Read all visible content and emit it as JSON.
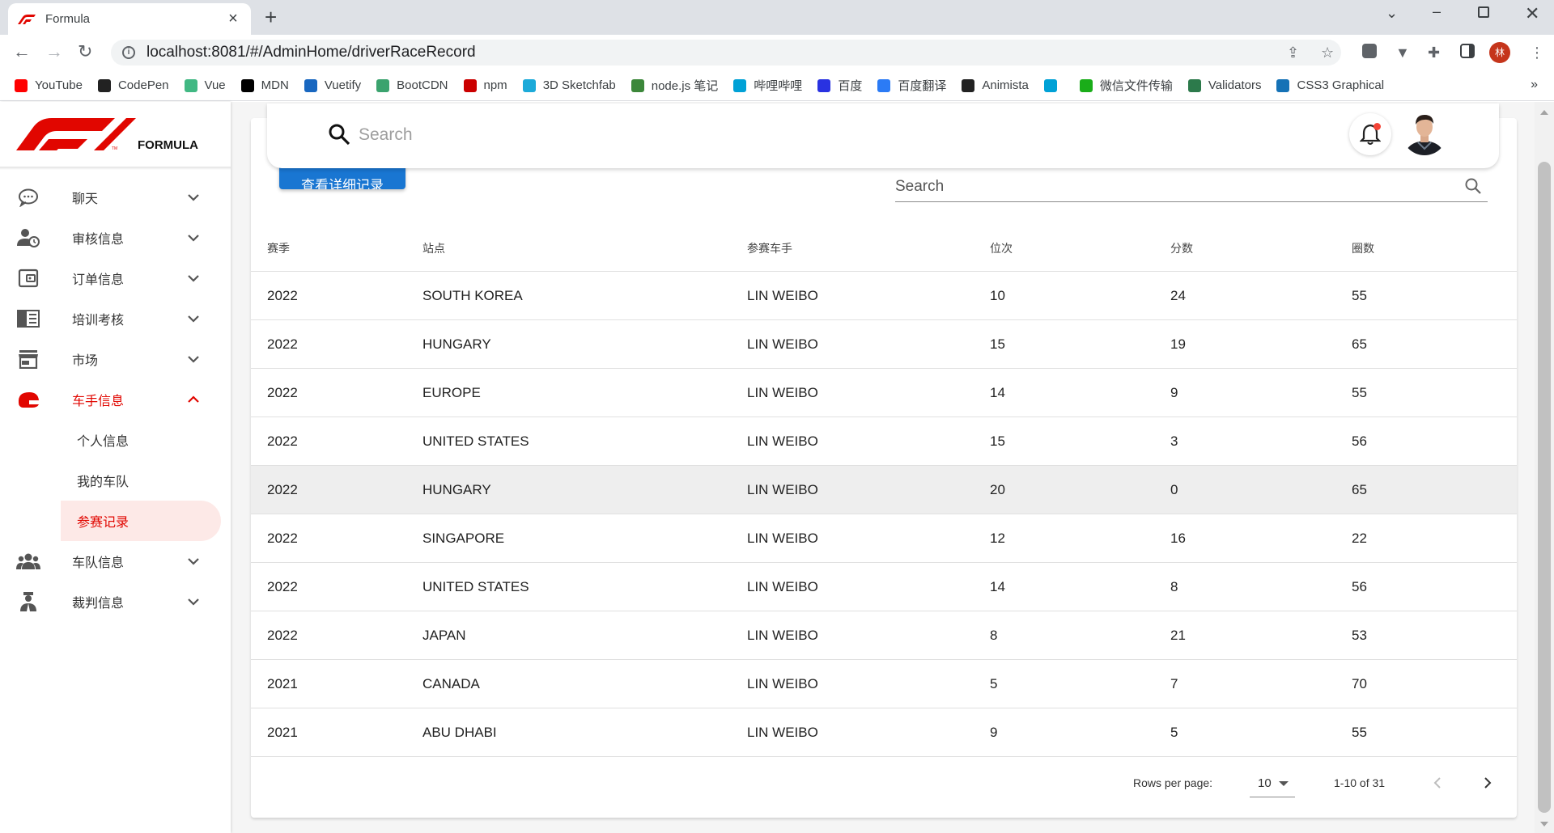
{
  "browser": {
    "tab_title": "Formula",
    "url": "localhost:8081/#/AdminHome/driverRaceRecord",
    "profile_initial": "林",
    "bookmarks": [
      {
        "label": "YouTube",
        "color": "#ff0000"
      },
      {
        "label": "CodePen",
        "color": "#222222"
      },
      {
        "label": "Vue",
        "color": "#41b883"
      },
      {
        "label": "MDN",
        "color": "#000000"
      },
      {
        "label": "Vuetify",
        "color": "#1867c0"
      },
      {
        "label": "BootCDN",
        "color": "#3ba36e"
      },
      {
        "label": "npm",
        "color": "#cb0000"
      },
      {
        "label": "3D Sketchfab",
        "color": "#1caad9"
      },
      {
        "label": "node.js 笔记",
        "color": "#3c873a"
      },
      {
        "label": "哔哩哔哩",
        "color": "#00a1d6"
      },
      {
        "label": "百度",
        "color": "#2932e1"
      },
      {
        "label": "百度翻译",
        "color": "#2b7bf5"
      },
      {
        "label": "Animista",
        "color": "#222222"
      },
      {
        "label": "",
        "color": "#00a1d6"
      },
      {
        "label": "微信文件传输",
        "color": "#1aad19"
      },
      {
        "label": "Validators",
        "color": "#2c7a4b"
      },
      {
        "label": "CSS3 Graphical",
        "color": "#1572b6"
      }
    ],
    "bookmarks_more": "»"
  },
  "brand": {
    "logo_text": "FORMULA",
    "logo_color": "#e10600"
  },
  "sidebar": {
    "items": [
      {
        "label": "聊天",
        "icon": "chat-icon"
      },
      {
        "label": "审核信息",
        "icon": "user-clock-icon"
      },
      {
        "label": "订单信息",
        "icon": "wallet-icon"
      },
      {
        "label": "培训考核",
        "icon": "book-icon"
      },
      {
        "label": "市场",
        "icon": "store-icon"
      },
      {
        "label": "车手信息",
        "icon": "helmet-icon"
      }
    ],
    "sub_items": [
      {
        "label": "个人信息"
      },
      {
        "label": "我的车队"
      },
      {
        "label": "参赛记录"
      }
    ],
    "bottom_items": [
      {
        "label": "车队信息",
        "icon": "group-icon"
      },
      {
        "label": "裁判信息",
        "icon": "referee-icon"
      }
    ]
  },
  "topbar": {
    "search_placeholder": "Search"
  },
  "content": {
    "detail_button": "查看详细记录",
    "table_search_placeholder": "Search",
    "columns": [
      "赛季",
      "站点",
      "参赛车手",
      "位次",
      "分数",
      "圈数"
    ],
    "rows": [
      [
        "2022",
        "SOUTH KOREA",
        "LIN WEIBO",
        "10",
        "24",
        "55"
      ],
      [
        "2022",
        "HUNGARY",
        "LIN WEIBO",
        "15",
        "19",
        "65"
      ],
      [
        "2022",
        "EUROPE",
        "LIN WEIBO",
        "14",
        "9",
        "55"
      ],
      [
        "2022",
        "UNITED STATES",
        "LIN WEIBO",
        "15",
        "3",
        "56"
      ],
      [
        "2022",
        "HUNGARY",
        "LIN WEIBO",
        "20",
        "0",
        "65"
      ],
      [
        "2022",
        "SINGAPORE",
        "LIN WEIBO",
        "12",
        "16",
        "22"
      ],
      [
        "2022",
        "UNITED STATES",
        "LIN WEIBO",
        "14",
        "8",
        "56"
      ],
      [
        "2022",
        "JAPAN",
        "LIN WEIBO",
        "8",
        "21",
        "53"
      ],
      [
        "2021",
        "CANADA",
        "LIN WEIBO",
        "5",
        "7",
        "70"
      ],
      [
        "2021",
        "ABU DHABI",
        "LIN WEIBO",
        "9",
        "5",
        "55"
      ]
    ],
    "footer": {
      "rows_per_page_label": "Rows per page:",
      "rows_per_page_value": "10",
      "range_text": "1-10 of 31"
    }
  }
}
